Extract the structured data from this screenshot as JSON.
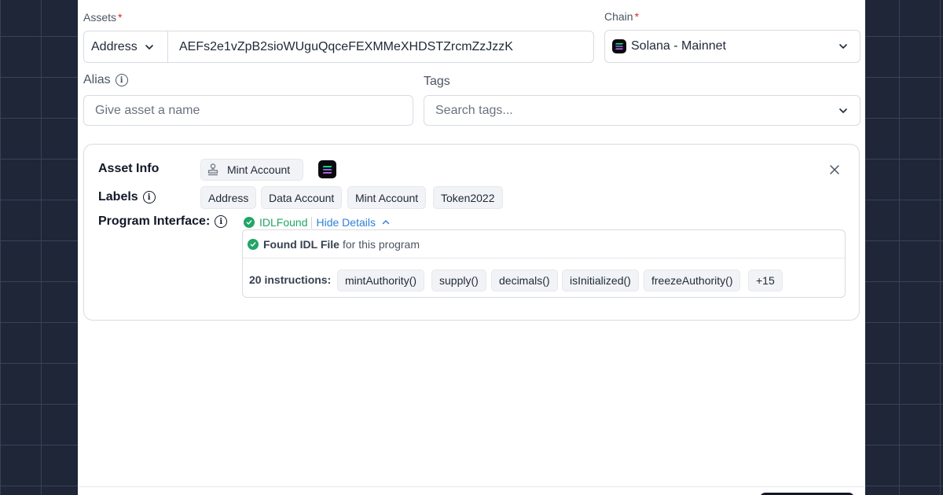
{
  "form": {
    "assets_label": "Assets",
    "required_mark": "*",
    "address_type": "Address",
    "address_value": "AEFs2e1vZpB2sioWUguQqceFEXMMeXHDSTZrcmZzJzzK",
    "chain_label": "Chain",
    "chain_value": "Solana - Mainnet",
    "alias_label": "Alias",
    "alias_placeholder": "Give asset a name",
    "tags_label": "Tags",
    "tags_placeholder": "Search tags..."
  },
  "asset_info": {
    "title": "Asset Info",
    "account_type": "Mint Account",
    "labels_title": "Labels",
    "labels": [
      "Address",
      "Data Account",
      "Mint Account",
      "Token2022"
    ],
    "program_interface_title": "Program Interface:",
    "idl_status": "IDLFound",
    "hide_details": "Hide Details",
    "found_bold": "Found IDL File",
    "found_rest": "for this program",
    "instructions_count": "20 instructions:",
    "instructions": [
      "mintAuthority()",
      "supply()",
      "decimals()",
      "isInitialized()",
      "freezeAuthority()"
    ],
    "more": "+15"
  },
  "colors": {
    "background": "#1e2638",
    "success": "#22a565",
    "link": "#2f80d9",
    "required": "#dc2626"
  },
  "icons": [
    "chevron-down-icon",
    "info-icon",
    "solana-icon",
    "stamp-icon",
    "close-icon",
    "check-circle-icon",
    "chevron-up-icon"
  ]
}
